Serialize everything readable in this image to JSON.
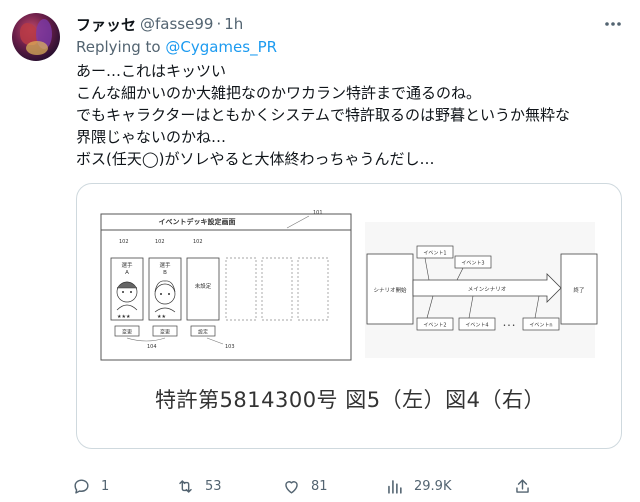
{
  "user": {
    "display_name": "ファッセ",
    "handle": "@fasse99",
    "separator": "·",
    "time": "1h"
  },
  "reply": {
    "prefix": "Replying to",
    "mention": "@Cygames_PR"
  },
  "tweet_lines": [
    "あー…これはキッツい",
    "こんな細かいのか大雑把なのかワカラン特許まで通るのね。",
    "でもキャラクターはともかくシステムで特許取るのは野暮というか無粋な",
    "界隈じゃないのかね…",
    "ボス(任天◯)がソレやると大体終わっちゃうんだし…"
  ],
  "media": {
    "caption": "特許第5814300号 図5（左）図4（右）",
    "fig5": {
      "title": "イベントデッキ設定画面",
      "ref_101": "101",
      "ref_102a": "102",
      "ref_102b": "102",
      "ref_102c": "102",
      "ref_104": "104",
      "ref_103": "103",
      "card_a": "選手\nA",
      "card_a_l1": "選手",
      "card_a_l2": "A",
      "card_b_l1": "選手",
      "card_b_l2": "B",
      "card_c": "未設定",
      "stars_a": "★★★",
      "stars_b": "★★",
      "btn_change_1": "変更",
      "btn_change_2": "変更",
      "btn_set": "設定"
    },
    "fig4": {
      "start": "シナリオ開始",
      "main": "メインシナリオ",
      "end": "終了",
      "event1": "イベント1",
      "event2": "イベント2",
      "event3": "イベント3",
      "event4": "イベント4",
      "eventn": "イベントn",
      "ellipsis": "• • •"
    }
  },
  "actions": {
    "reply_count": "1",
    "retweet_count": "53",
    "like_count": "81",
    "views_count": "29.9K"
  },
  "icons": [
    "more-icon",
    "reply-icon",
    "retweet-icon",
    "like-icon",
    "views-icon",
    "share-icon"
  ],
  "colors": {
    "link": "#1d9bf0",
    "secondary": "#536471",
    "border": "#cfd9de"
  }
}
